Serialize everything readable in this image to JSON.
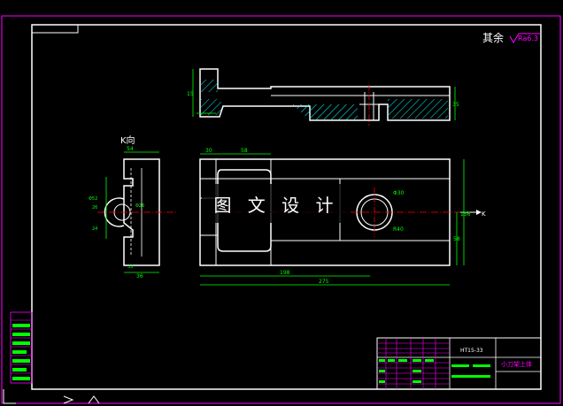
{
  "roughness_note": {
    "prefix": "其余",
    "value": "Ra6.3"
  },
  "view_label": "K向",
  "watermark": "图 文 设 计",
  "section_marker": "K",
  "title_block": {
    "material": "HT15-33",
    "part_name": "小刀架上体"
  },
  "dimensions": {
    "top_view_left_height": "15",
    "top_view_right_height": "35",
    "front_left_width": "30",
    "front_slot_width": "58",
    "front_length": "198",
    "front_total_length": "275",
    "front_height": "156",
    "front_lower_height": "58",
    "hole_diameter": "Φ30",
    "hole_radius": "R40",
    "k_width_top": "54",
    "k_width_bottom": "36",
    "k_inner": "33",
    "k_height_a": "Φ52",
    "k_height_b": "26",
    "k_height_c": "24",
    "k_bore": "Φ26"
  },
  "colors": {
    "background": "#000000",
    "outline": "#ffffff",
    "border_magenta": "#ff00ff",
    "dimension_green": "#00ff00",
    "centerline_red": "#ff0000",
    "table_magenta": "#ff00ff"
  }
}
